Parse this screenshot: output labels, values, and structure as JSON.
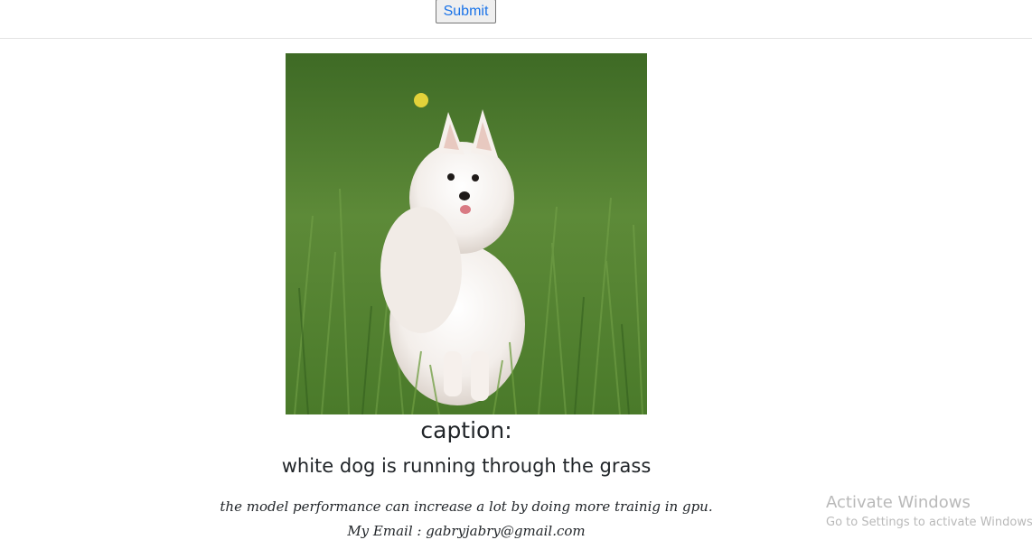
{
  "form": {
    "submit_label": "Submit"
  },
  "result": {
    "image_alt": "white dog sitting in grass",
    "caption_label": "caption:",
    "caption_text": "white dog is running through the grass"
  },
  "footer": {
    "note": "the model performance can increase a lot by doing more trainig in gpu.",
    "email": "My Email : gabryjabry@gmail.com"
  },
  "watermark": {
    "title": "Activate Windows",
    "subtitle": "Go to Settings to activate Windows."
  },
  "colors": {
    "link_blue": "#1a73e8",
    "grass": "#4f7a2e",
    "watermark": "#b9b9b9"
  }
}
